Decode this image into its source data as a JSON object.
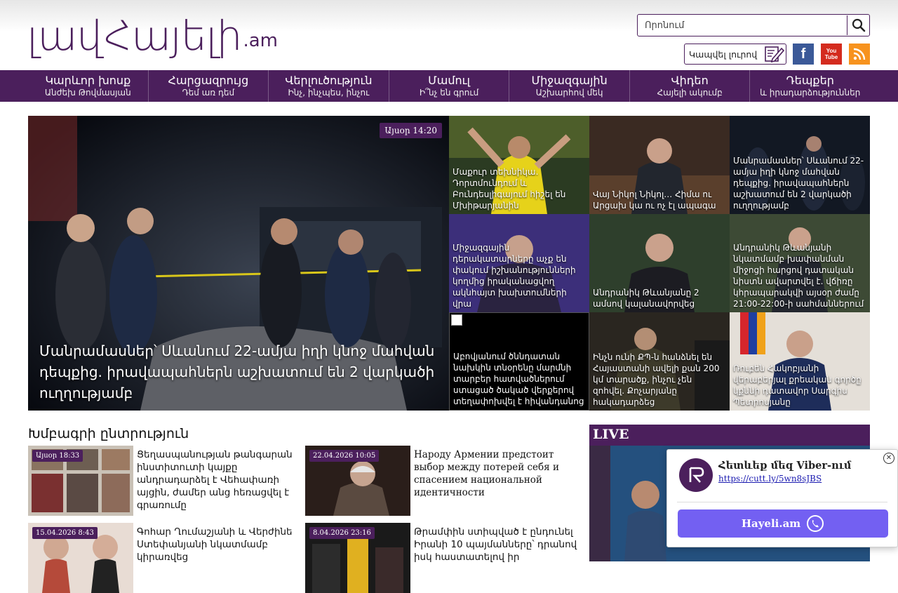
{
  "header": {
    "logo_text": "լավՀայելի",
    "logo_tld": ".am",
    "search_placeholder": "Որոնում",
    "contact_label": "Կապվել լուրով",
    "social": {
      "facebook": "f",
      "youtube_top": "You",
      "youtube_bottom": "Tube"
    }
  },
  "nav": [
    {
      "title": "Կարևոր խոսք",
      "sub": "Անժեխ Թովմասյան"
    },
    {
      "title": "Հարցազրույց",
      "sub": "Դեմ առ դեմ"
    },
    {
      "title": "Վերլուծություն",
      "sub": "Ինչ, ինչպես, ինչու"
    },
    {
      "title": "Մամուլ",
      "sub": "Ի՞նչ են գրում"
    },
    {
      "title": "Միջազգային",
      "sub": "Աշխարհով մեկ"
    },
    {
      "title": "Վիդեո",
      "sub": "Հայելի ակումբ"
    },
    {
      "title": "Դեպքեր",
      "sub": "և իրադարձություններ"
    }
  ],
  "hero": {
    "date": "Այսօր 14:20",
    "title": "Մանրամասներ՝ Սևանում 22-ամյա իղի կնոջ մահվան դեպքից. իրավապահներն աշխատում են 2 վարկածի ուղղությամբ"
  },
  "tiles": [
    {
      "title": "Մաքուր տեխնիկա. Դորտմունդում և Բունդեսլիգայում հիշել են Մխիթարյանին"
    },
    {
      "title": "Վայ Նիկոլ Նիկոլ… Հիմա ու Արցախ կա ու ոչ էլ ապագա"
    },
    {
      "title": "Մանրամասներ՝ Սևանում 22-ամյա իղի կնոջ մահվան դեպքից. իրավապահներն աշխատում են 2 վարկածի ուղղությամբ"
    },
    {
      "title": "Միջազգային դերակատարները աչք են փակում իշխանությունների կողմից իրականացվող ակնհայտ խախտումների վրա"
    },
    {
      "title": "Անդրանիկ Թևանյանը 2 ամսով կալանավորվեց"
    },
    {
      "title": "Անդրանիկ Թևանյանի նկատմամբ խափանման միջոցի հարցով դատական նիստն ավարտվել է. վճիռը կհրապարակվի այսօր ժամը 21:00-22:00-ի սահմաններում"
    },
    {
      "title": "Աբովյանում ծննդատան նախկին տնօրենը մարմնի տարբեր հատվածներում ստացած ծակած վերքերով տեղափոխվել է հիվանդանոց"
    },
    {
      "title": "Ինչն ունի ՔՊ-ն հանձնել են Հայաստանի ավելի քան 200 կմ տարածք, ինչու չեն զոհվել. Քոչարյանը հակադարձեց"
    },
    {
      "title": "Ռուբեն Հակոբյանի վերաբերյալ քրեական գործը կքննի դատավոր Սարգիս Պետրոսյանը"
    }
  ],
  "editors": {
    "title": "Խմբագրի ընտրություն",
    "cards": [
      {
        "date": "Այսօր 18:33",
        "title": "Ցեղասպանության թանգարան ինստիտուտի կայքը անդրադարձել է Վեհափառի այցին, ժամեր անց հեռացվել է գրառումը"
      },
      {
        "date": "22.04.2026 10:05",
        "title": "Народу Армении предстоит выбор между потерей себя и спасением национальной идентичности"
      },
      {
        "date": "15.04.2026 8:43",
        "title": "Գոհար Ղումաշյանի և Վերժինե Ստեփանյանի նկատմամբ կիրառվեց"
      },
      {
        "date": "8.04.2026 23:16",
        "title": "Թրամփին ստիպված է ընդունել Իրանի 10 պայմանները՝ դրանով իսկ հաստատելով իր"
      }
    ]
  },
  "live": {
    "label": "LIVE"
  },
  "viber": {
    "title": "Հետևեք մեզ Viber-ում",
    "link": "https://cutt.ly/5wn8sJBS",
    "button": "Hayeli.am",
    "close": "✕"
  },
  "colors": {
    "brand": "#4b1f5c",
    "viber": "#7360f2"
  }
}
